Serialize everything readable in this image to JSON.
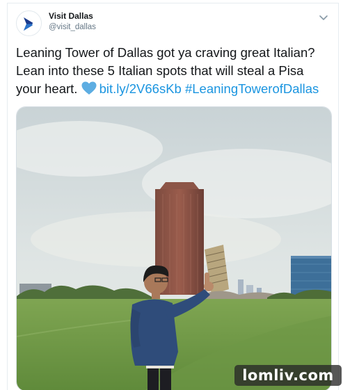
{
  "tweet": {
    "author_name": "Visit Dallas",
    "author_handle": "@visit_dallas",
    "text_before_link": "Leaning Tower of Dallas got ya craving great Italian? Lean into these 5 Italian spots that will steal a Pisa your heart. ",
    "heart_icon": "blue-heart-emoji",
    "link": "bit.ly/2V66sKb",
    "hashtag": "#LeaningTowerofDallas",
    "link_color": "#1b95e0",
    "caret_icon": "chevron-down-icon"
  },
  "media": {
    "description_icon": "photo"
  },
  "watermark": {
    "text": "lomliv.com"
  }
}
